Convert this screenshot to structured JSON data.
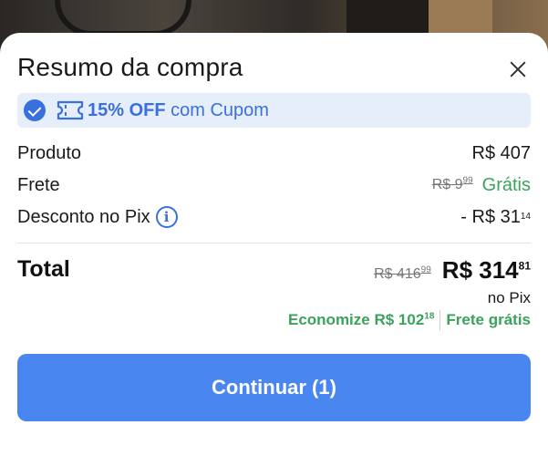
{
  "header": {
    "title": "Resumo da compra"
  },
  "coupon": {
    "discount": "15% OFF",
    "text": "com Cupom"
  },
  "rows": {
    "produto": {
      "label": "Produto",
      "value": "R$ 407"
    },
    "frete": {
      "label": "Frete",
      "old_int": "R$ 9",
      "old_cents": "99",
      "value": "Grátis"
    },
    "desconto": {
      "label": "Desconto no Pix",
      "value_int": "- R$ 31",
      "value_cents": "14"
    }
  },
  "total": {
    "label": "Total",
    "old_int": "R$ 416",
    "old_cents": "99",
    "main_int": "R$ 314",
    "main_cents": "81",
    "method": "no Pix",
    "savings_int": "Economize R$ 102",
    "savings_cents": "18",
    "shipping": "Frete grátis"
  },
  "cta": {
    "label": "Continuar (1)"
  },
  "colors": {
    "accent": "#3a6fe0",
    "button": "#4a86f0",
    "green": "#3aa35b"
  }
}
